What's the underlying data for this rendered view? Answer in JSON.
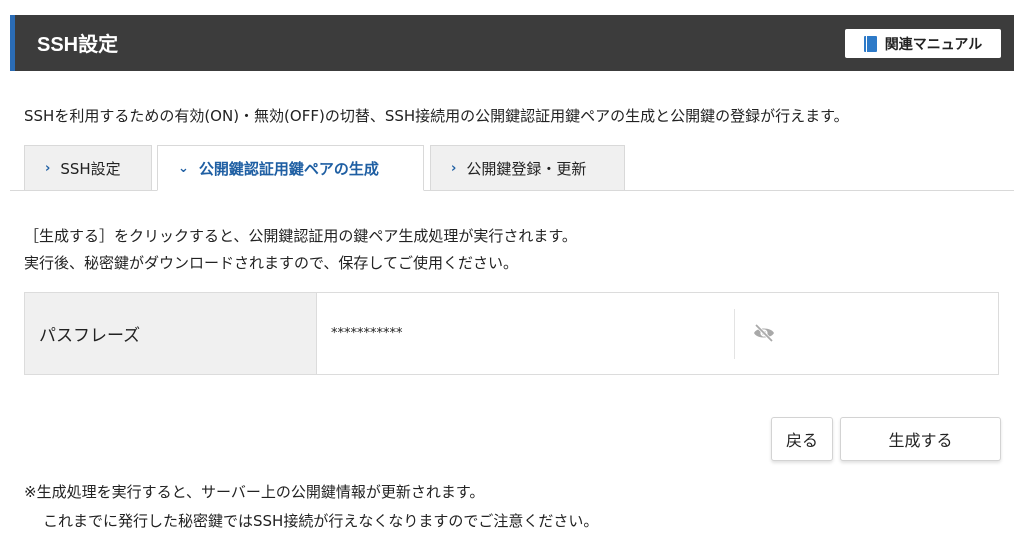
{
  "header": {
    "title": "SSH設定",
    "manual_button": "関連マニュアル"
  },
  "description": "SSHを利用するための有効(ON)・無効(OFF)の切替、SSH接続用の公開鍵認証用鍵ペアの生成と公開鍵の登録が行えます。",
  "tabs": [
    {
      "label": "SSH設定",
      "active": false
    },
    {
      "label": "公開鍵認証用鍵ペアの生成",
      "active": true
    },
    {
      "label": "公開鍵登録・更新",
      "active": false
    }
  ],
  "tab_chevrons": {
    "collapsed": "›",
    "expanded": "⌄"
  },
  "instructions": {
    "line1": "［生成する］をクリックすると、公開鍵認証用の鍵ペア生成処理が実行されます。",
    "line2": "実行後、秘密鍵がダウンロードされますので、保存してご使用ください。"
  },
  "form": {
    "passphrase_label": "パスフレーズ",
    "passphrase_value": "***********"
  },
  "buttons": {
    "back": "戻る",
    "generate": "生成する"
  },
  "notes": {
    "line1": "※生成処理を実行すると、サーバー上の公開鍵情報が更新されます。",
    "line2": "これまでに発行した秘密鍵ではSSH接続が行えなくなりますのでご注意ください。"
  },
  "icons": {
    "manual": "book-icon",
    "toggle_visibility": "eye-slash-icon"
  },
  "colors": {
    "header_bg": "#3c3c3c",
    "header_accent": "#2b6cb5",
    "active_tab_text": "#1f5fa3",
    "book_icon": "#2d7ac8"
  }
}
